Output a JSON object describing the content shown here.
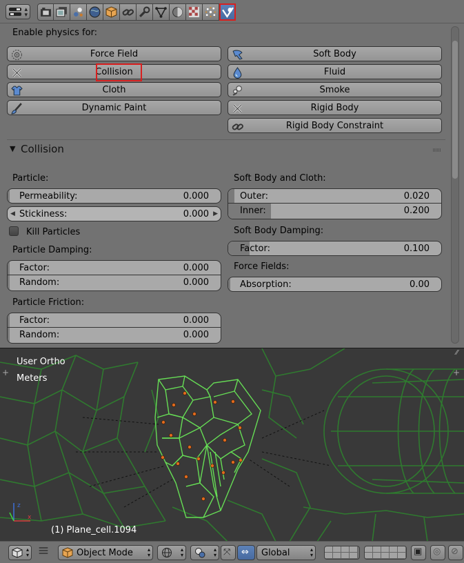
{
  "header": {
    "context_tabs": [
      "render-icon",
      "render-layers-icon",
      "scene-icon",
      "world-icon",
      "object-icon",
      "constraints-icon",
      "modifiers-icon",
      "object-data-icon",
      "material-icon",
      "texture-icon",
      "particles-icon",
      "physics-icon"
    ],
    "active_tab": "physics-icon"
  },
  "physics": {
    "enable_label": "Enable physics for:",
    "left_buttons": [
      {
        "label": "Force Field",
        "icon": "force-field-icon"
      },
      {
        "label": "Collision",
        "icon": "collision-icon"
      },
      {
        "label": "Cloth",
        "icon": "cloth-icon"
      },
      {
        "label": "Dynamic Paint",
        "icon": "dynamic-paint-icon"
      }
    ],
    "right_buttons": [
      {
        "label": "Soft Body",
        "icon": "soft-body-icon"
      },
      {
        "label": "Fluid",
        "icon": "fluid-icon"
      },
      {
        "label": "Smoke",
        "icon": "smoke-icon"
      },
      {
        "label": "Rigid Body",
        "icon": "rigid-body-icon"
      },
      {
        "label": "Rigid Body Constraint",
        "icon": "rigid-body-constraint-icon"
      }
    ]
  },
  "collision": {
    "title": "Collision",
    "particle": {
      "label": "Particle:",
      "permeability": {
        "label": "Permeability:",
        "value": "0.000"
      },
      "stickiness": {
        "label": "Stickiness:",
        "value": "0.000"
      },
      "kill_particles": {
        "label": "Kill Particles",
        "checked": false
      }
    },
    "particle_damping": {
      "label": "Particle Damping:",
      "factor": {
        "label": "Factor:",
        "value": "0.000"
      },
      "random": {
        "label": "Random:",
        "value": "0.000"
      }
    },
    "particle_friction": {
      "label": "Particle Friction:",
      "factor": {
        "label": "Factor:",
        "value": "0.000"
      },
      "random": {
        "label": "Random:",
        "value": "0.000"
      }
    },
    "soft_body_cloth": {
      "label": "Soft Body and Cloth:",
      "outer": {
        "label": "Outer:",
        "value": "0.020",
        "fraction": 0.02
      },
      "inner": {
        "label": "Inner:",
        "value": "0.200",
        "fraction": 0.2
      }
    },
    "soft_body_damping": {
      "label": "Soft Body Damping:",
      "factor": {
        "label": "Factor:",
        "value": "0.100",
        "fraction": 0.1
      }
    },
    "force_fields": {
      "label": "Force Fields:",
      "absorption": {
        "label": "Absorption:",
        "value": "0.00"
      }
    }
  },
  "viewport": {
    "view_name": "User Ortho",
    "units": "Meters",
    "object_info": "(1) Plane_cell.1094"
  },
  "footer": {
    "mode": "Object Mode",
    "orientation": "Global"
  },
  "colors": {
    "accent_active": "#5d82b8",
    "highlight": "#d81f1f",
    "wireframe": "#2f7a2f",
    "selected_wire": "#66dd55",
    "particle_dot": "#e06a1e"
  }
}
